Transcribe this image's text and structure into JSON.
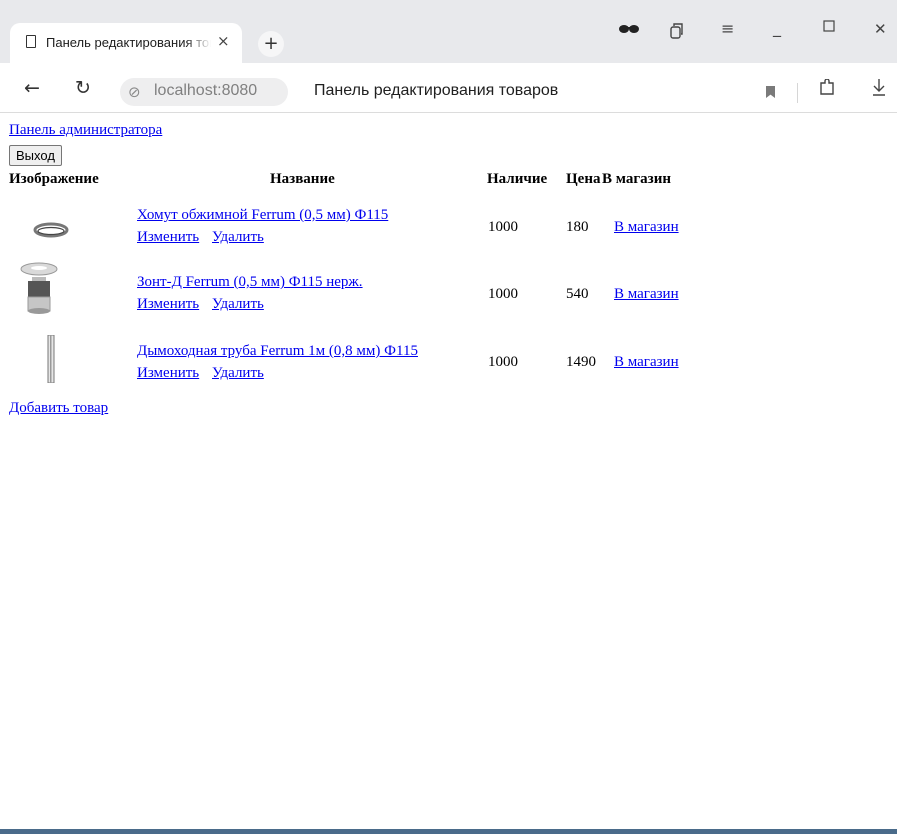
{
  "browser": {
    "tab_title": "Панель редактирования товаров",
    "tab_close": "×",
    "new_tab": "+",
    "url": "localhost:8080",
    "page_title": "Панель редактирования товаров",
    "icons": [
      "incognito-glasses-icon",
      "tabs-icon",
      "menu-icon",
      "minimize-icon",
      "maximize-icon",
      "close-icon",
      "back-icon",
      "reload-icon",
      "site-info-icon",
      "bookmark-icon",
      "extensions-icon",
      "download-icon"
    ],
    "glyphs": {
      "glasses": "••",
      "tabs": "⧉",
      "menu": "≡",
      "minimize": "_",
      "maximize": "☐",
      "close": "✕",
      "back": "←",
      "reload": "↻",
      "site": "⊘",
      "download": "⤓",
      "extensions": "⊡"
    }
  },
  "page": {
    "admin_link": "Панель администратора",
    "logout_button": "Выход",
    "columns": {
      "image": "Изображение",
      "name": "Название",
      "stock": "Наличие",
      "price": "Цена",
      "store": "В магазин"
    },
    "products": [
      {
        "name": "Хомут обжимной Ferrum (0,5 мм) Ф115",
        "edit": "Изменить",
        "delete": "Удалить",
        "stock": "1000",
        "price": "180",
        "store": "В магазин",
        "image": "clamp-ring"
      },
      {
        "name": "Зонт-Д Ferrum (0,5 мм) Ф115 нерж.",
        "edit": "Изменить",
        "delete": "Удалить",
        "stock": "1000",
        "price": "540",
        "store": "В магазин",
        "image": "chimney-cap"
      },
      {
        "name": "Дымоходная труба Ferrum 1м (0,8 мм) Ф115",
        "edit": "Изменить",
        "delete": "Удалить",
        "stock": "1000",
        "price": "1490",
        "store": "В магазин",
        "image": "chimney-pipe"
      }
    ],
    "add_link": "Добавить товар"
  },
  "colors": {
    "link": "#0000ee",
    "chrome_bg": "#e8e9ec"
  }
}
